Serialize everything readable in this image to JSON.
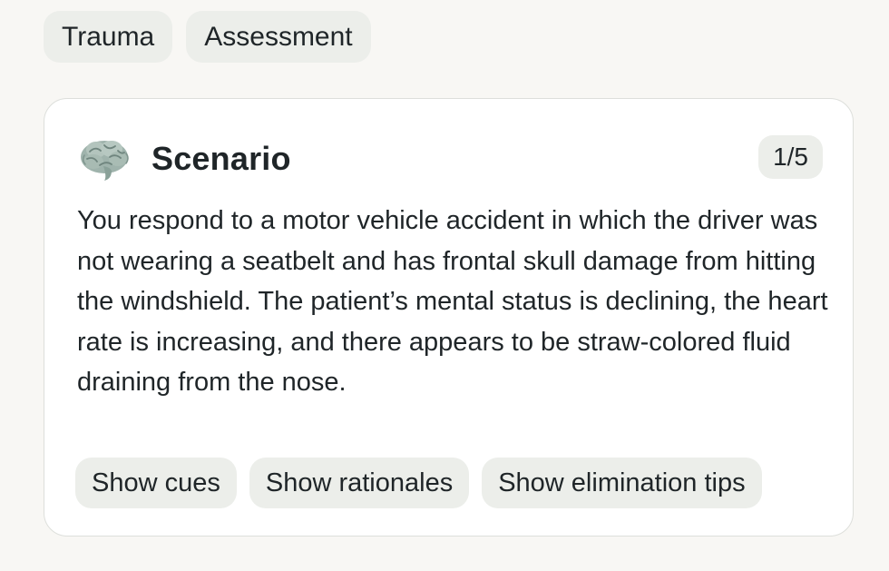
{
  "tags": [
    {
      "label": "Trauma"
    },
    {
      "label": "Assessment"
    }
  ],
  "card": {
    "icon": "brain-icon",
    "title": "Scenario",
    "counter": "1/5",
    "text": "You respond to a motor vehicle accident in which the driver was not wearing a seatbelt and has frontal skull damage from hitting the windshield. The patient’s mental status is declining, the heart rate is increasing, and there appears to be straw-colored fluid draining from the nose.",
    "actions": [
      {
        "label": "Show cues"
      },
      {
        "label": "Show rationales"
      },
      {
        "label": "Show elimination tips"
      }
    ]
  },
  "colors": {
    "page_background": "#f8f7f4",
    "chip_background": "#eceeea",
    "card_background": "#ffffff",
    "text": "#1f2528",
    "brain": "#9fb3ac"
  }
}
